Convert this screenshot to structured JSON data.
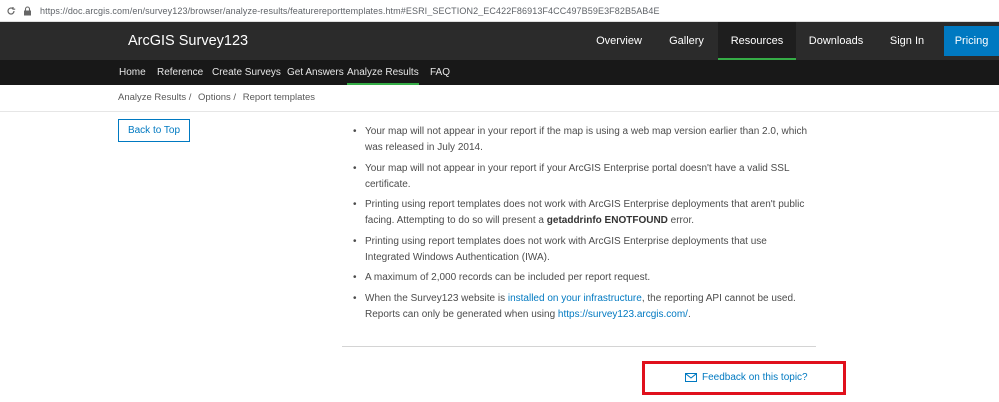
{
  "browser": {
    "url": "https://doc.arcgis.com/en/survey123/browser/analyze-results/featurereporttemplates.htm#ESRI_SECTION2_EC422F86913F4CC497B59E3F82B5AB4E"
  },
  "header": {
    "brand": "ArcGIS Survey123",
    "nav": [
      "Overview",
      "Gallery",
      "Resources",
      "Downloads",
      "Sign In"
    ],
    "active_nav": "Resources",
    "pricing": "Pricing"
  },
  "subnav": {
    "items": [
      "Home",
      "Reference",
      "Create Surveys",
      "Get Answers",
      "Analyze Results",
      "FAQ"
    ],
    "active": "Analyze Results"
  },
  "breadcrumb": [
    "Analyze Results /",
    "Options /",
    "Report templates"
  ],
  "back_to_top": "Back to Top",
  "bullets": [
    {
      "line1": "Your map will not appear in your report if the map is using a web map version earlier than 2.0, which",
      "line2": "was released in July 2014."
    },
    {
      "line1": "Your map will not appear in your report if your ArcGIS Enterprise portal doesn't have a valid SSL",
      "line2": "certificate."
    },
    {
      "line1": "Printing using report templates does not work with ArcGIS Enterprise deployments that aren't public",
      "line2_pre": "facing. Attempting to do so will present a ",
      "line2_bold": "getaddrinfo ENOTFOUND",
      "line2_post": " error."
    },
    {
      "line1": "Printing using report templates does not work with ArcGIS Enterprise deployments that use",
      "line2": "Integrated Windows Authentication (IWA)."
    },
    {
      "line1": "A maximum of 2,000 records can be included per report request."
    },
    {
      "line1_pre": "When the Survey123 website is ",
      "line1_link": "installed on your infrastructure",
      "line1_post": ", the reporting API cannot be used.",
      "line2_pre": "Reports can only be generated when using ",
      "line2_link": "https://survey123.arcgis.com/",
      "line2_post": "."
    }
  ],
  "feedback": "Feedback on this topic?",
  "colors": {
    "accent_green": "#35ac46",
    "link_blue": "#0079c1",
    "highlight_red": "#e0101c"
  }
}
